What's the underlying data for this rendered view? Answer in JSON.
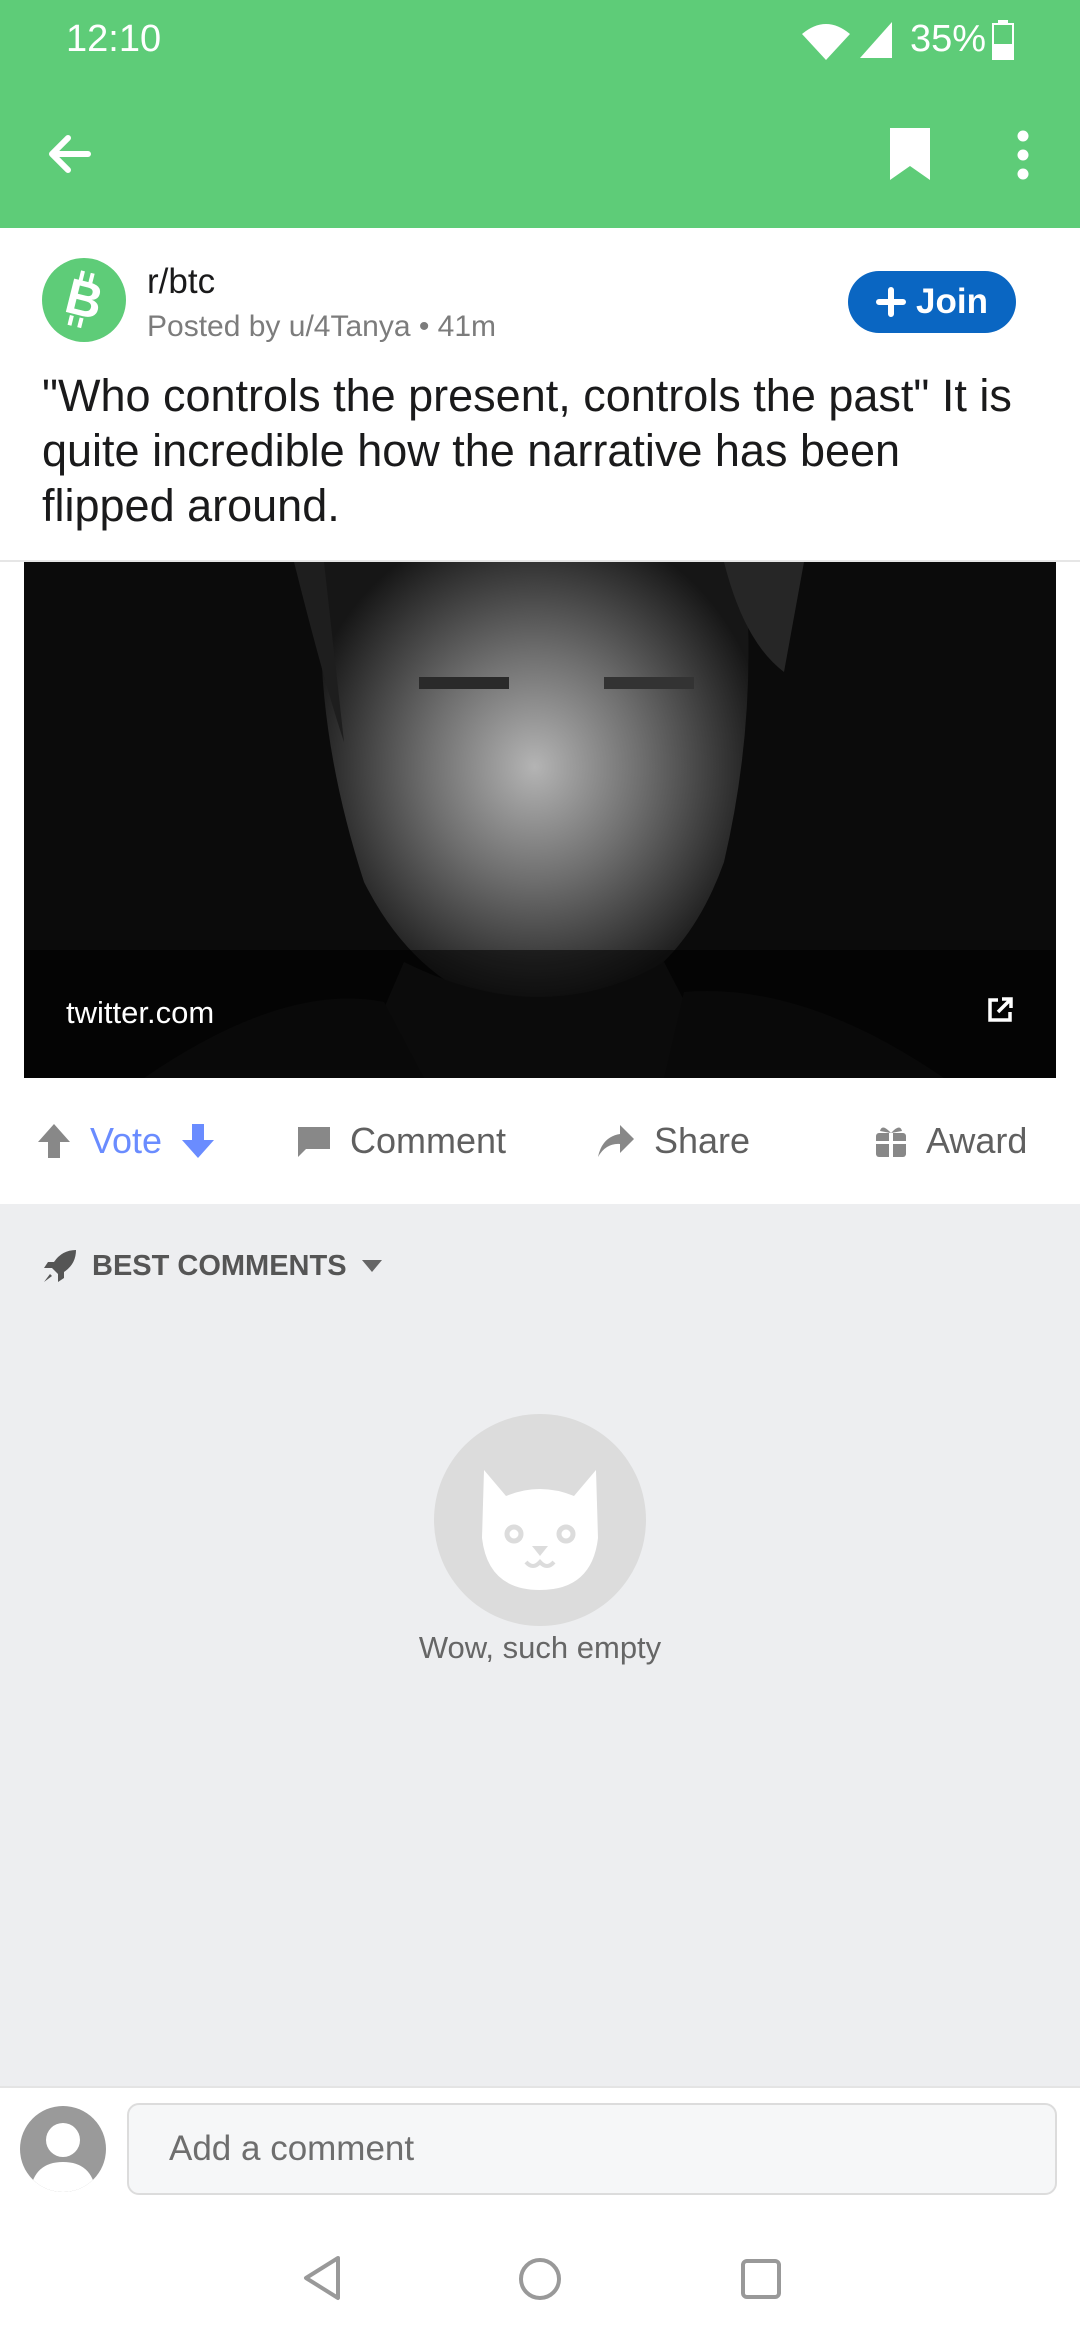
{
  "status_bar": {
    "time": "12:10",
    "battery": "35%"
  },
  "app_bar": {
    "icons": [
      "back-arrow-icon",
      "bookmark-icon",
      "more-vert-icon"
    ]
  },
  "post": {
    "subreddit": "r/btc",
    "posted_by": "Posted by u/4Tanya • 41m",
    "join_label": "Join",
    "title": "\"Who controls the present, controls the past\" It is quite incredible how the narrative has been flipped around.",
    "link_domain": "twitter.com"
  },
  "actions": {
    "vote": "Vote",
    "comment": "Comment",
    "share": "Share",
    "award": "Award"
  },
  "comments": {
    "sort_label": "BEST COMMENTS",
    "empty_text": "Wow, such empty"
  },
  "comment_input": {
    "placeholder": "Add a comment"
  },
  "colors": {
    "accent_green": "#5ecc78",
    "join_blue": "#0a66c2",
    "vote_blue": "#6a8cff"
  }
}
